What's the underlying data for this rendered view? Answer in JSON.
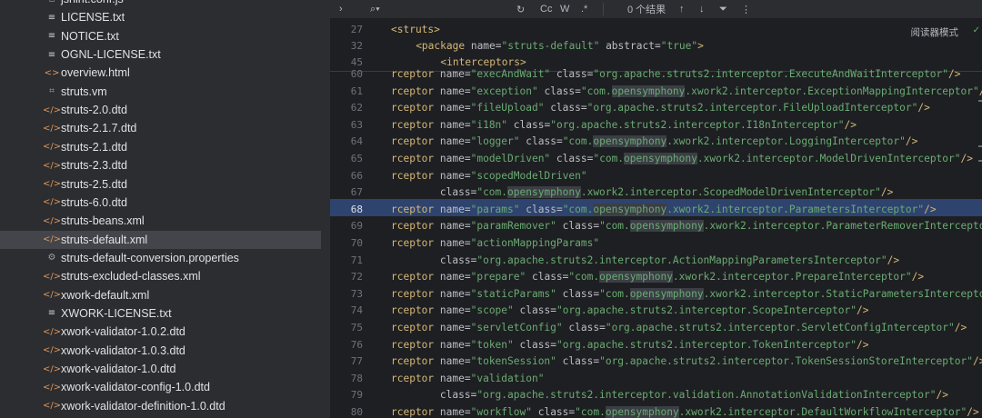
{
  "sidebar": {
    "items": [
      {
        "icon": "js-file-icon",
        "label": "jshint.conf.js",
        "glyph": "▫"
      },
      {
        "icon": "text-file-icon",
        "label": "LICENSE.txt",
        "glyph": "≡"
      },
      {
        "icon": "text-file-icon",
        "label": "NOTICE.txt",
        "glyph": "≡"
      },
      {
        "icon": "text-file-icon",
        "label": "OGNL-LICENSE.txt",
        "glyph": "≡"
      },
      {
        "icon": "html-file-icon",
        "label": "overview.html",
        "glyph": "<>"
      },
      {
        "icon": "template-file-icon",
        "label": "struts.vm",
        "glyph": "⌗"
      },
      {
        "icon": "dtd-file-icon",
        "label": "struts-2.0.dtd",
        "glyph": "</>"
      },
      {
        "icon": "dtd-file-icon",
        "label": "struts-2.1.7.dtd",
        "glyph": "</>"
      },
      {
        "icon": "dtd-file-icon",
        "label": "struts-2.1.dtd",
        "glyph": "</>"
      },
      {
        "icon": "dtd-file-icon",
        "label": "struts-2.3.dtd",
        "glyph": "</>"
      },
      {
        "icon": "dtd-file-icon",
        "label": "struts-2.5.dtd",
        "glyph": "</>"
      },
      {
        "icon": "dtd-file-icon",
        "label": "struts-6.0.dtd",
        "glyph": "</>"
      },
      {
        "icon": "xml-file-icon",
        "label": "struts-beans.xml",
        "glyph": "</>"
      },
      {
        "icon": "xml-file-icon",
        "label": "struts-default.xml",
        "glyph": "</>"
      },
      {
        "icon": "properties-file-icon",
        "label": "struts-default-conversion.properties",
        "glyph": "⚙"
      },
      {
        "icon": "xml-file-icon",
        "label": "struts-excluded-classes.xml",
        "glyph": "</>"
      },
      {
        "icon": "xml-file-icon",
        "label": "xwork-default.xml",
        "glyph": "</>"
      },
      {
        "icon": "text-file-icon",
        "label": "XWORK-LICENSE.txt",
        "glyph": "≡"
      },
      {
        "icon": "dtd-file-icon",
        "label": "xwork-validator-1.0.2.dtd",
        "glyph": "</>"
      },
      {
        "icon": "dtd-file-icon",
        "label": "xwork-validator-1.0.3.dtd",
        "glyph": "</>"
      },
      {
        "icon": "dtd-file-icon",
        "label": "xwork-validator-1.0.dtd",
        "glyph": "</>"
      },
      {
        "icon": "dtd-file-icon",
        "label": "xwork-validator-config-1.0.dtd",
        "glyph": "</>"
      },
      {
        "icon": "dtd-file-icon",
        "label": "xwork-validator-definition-1.0.dtd",
        "glyph": "</>"
      }
    ],
    "selected_index": 13
  },
  "findbar": {
    "results_text": "0 个结果",
    "regex_label": ".*",
    "case_label": "Cc",
    "word_label": "W"
  },
  "reader_mode_label": "阅读器模式",
  "sticky_lines": [
    {
      "num": "27",
      "indent": "",
      "text": "<struts>"
    },
    {
      "num": "32",
      "indent": "    ",
      "text": "<package name=\"struts-default\" abstract=\"true\">"
    },
    {
      "num": "45",
      "indent": "        ",
      "text": "<interceptors>"
    }
  ],
  "code_lines": [
    {
      "num": "60",
      "text": "rceptor name=\"execAndWait\" class=\"org.apache.struts2.interceptor.ExecuteAndWaitInterceptor\"/>"
    },
    {
      "num": "61",
      "text": "rceptor name=\"exception\" class=\"com.opensymphony.xwork2.interceptor.ExceptionMappingInterceptor\"/>"
    },
    {
      "num": "62",
      "text": "rceptor name=\"fileUpload\" class=\"org.apache.struts2.interceptor.FileUploadInterceptor\"/>"
    },
    {
      "num": "63",
      "text": "rceptor name=\"i18n\" class=\"org.apache.struts2.interceptor.I18nInterceptor\"/>"
    },
    {
      "num": "64",
      "text": "rceptor name=\"logger\" class=\"com.opensymphony.xwork2.interceptor.LoggingInterceptor\"/>"
    },
    {
      "num": "65",
      "text": "rceptor name=\"modelDriven\" class=\"com.opensymphony.xwork2.interceptor.ModelDrivenInterceptor\"/>"
    },
    {
      "num": "66",
      "text": "rceptor name=\"scopedModelDriven\""
    },
    {
      "num": "67",
      "text": "        class=\"com.opensymphony.xwork2.interceptor.ScopedModelDrivenInterceptor\"/>"
    },
    {
      "num": "68",
      "text": "rceptor name=\"params\" class=\"com.opensymphony.xwork2.interceptor.ParametersInterceptor\"/>"
    },
    {
      "num": "69",
      "text": "rceptor name=\"paramRemover\" class=\"com.opensymphony.xwork2.interceptor.ParameterRemoverInterceptor\"/>"
    },
    {
      "num": "70",
      "text": "rceptor name=\"actionMappingParams\""
    },
    {
      "num": "71",
      "text": "        class=\"org.apache.struts2.interceptor.ActionMappingParametersInterceptor\"/>"
    },
    {
      "num": "72",
      "text": "rceptor name=\"prepare\" class=\"com.opensymphony.xwork2.interceptor.PrepareInterceptor\"/>"
    },
    {
      "num": "73",
      "text": "rceptor name=\"staticParams\" class=\"com.opensymphony.xwork2.interceptor.StaticParametersInterceptor\"/>"
    },
    {
      "num": "74",
      "text": "rceptor name=\"scope\" class=\"org.apache.struts2.interceptor.ScopeInterceptor\"/>"
    },
    {
      "num": "75",
      "text": "rceptor name=\"servletConfig\" class=\"org.apache.struts2.interceptor.ServletConfigInterceptor\"/>"
    },
    {
      "num": "76",
      "text": "rceptor name=\"token\" class=\"org.apache.struts2.interceptor.TokenInterceptor\"/>"
    },
    {
      "num": "77",
      "text": "rceptor name=\"tokenSession\" class=\"org.apache.struts2.interceptor.TokenSessionStoreInterceptor\"/>"
    },
    {
      "num": "78",
      "text": "rceptor name=\"validation\""
    },
    {
      "num": "79",
      "text": "        class=\"org.apache.struts2.interceptor.validation.AnnotationValidationInterceptor\"/>"
    },
    {
      "num": "80",
      "text": "rceptor name=\"workflow\" class=\"com.opensymphony.xwork2.interceptor.DefaultWorkflowInterceptor\"/>"
    }
  ],
  "current_line": "68",
  "highlight_word": "opensymphony"
}
